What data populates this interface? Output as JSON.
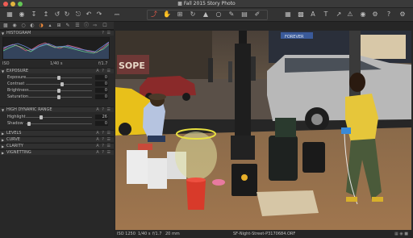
{
  "window": {
    "title": "Fall 2015 Story Photo"
  },
  "histogram": {
    "section_label": "HISTOGRAM",
    "iso": "ISO",
    "shutter": "1/40 s",
    "aperture": "f/1.7"
  },
  "exposure": {
    "section_label": "EXPOSURE",
    "sliders": [
      {
        "label": "Exposure",
        "value": "0",
        "position": 0.5
      },
      {
        "label": "Contrast",
        "value": "0",
        "position": 0.55
      },
      {
        "label": "Brightness",
        "value": "0",
        "position": 0.5
      },
      {
        "label": "Saturation",
        "value": "0",
        "position": 0.5
      }
    ]
  },
  "hdr": {
    "section_label": "HIGH DYNAMIC RANGE",
    "sliders": [
      {
        "label": "Highlight",
        "value": "26",
        "position": 0.22
      },
      {
        "label": "Shadow",
        "value": "0",
        "position": 0.02
      }
    ]
  },
  "collapsed_sections": [
    "LEVELS",
    "CURVE",
    "CLARITY",
    "VIGNETTING"
  ],
  "status": {
    "iso": "ISO 1250",
    "shutter": "1/40 s",
    "aperture": "f/1.7",
    "focal": "20 mm",
    "filename": "SF-Night-Street-P3170684.ORF"
  },
  "colors": {
    "accent": "#f08a3a",
    "toolbar_red": "#e05a4a"
  }
}
